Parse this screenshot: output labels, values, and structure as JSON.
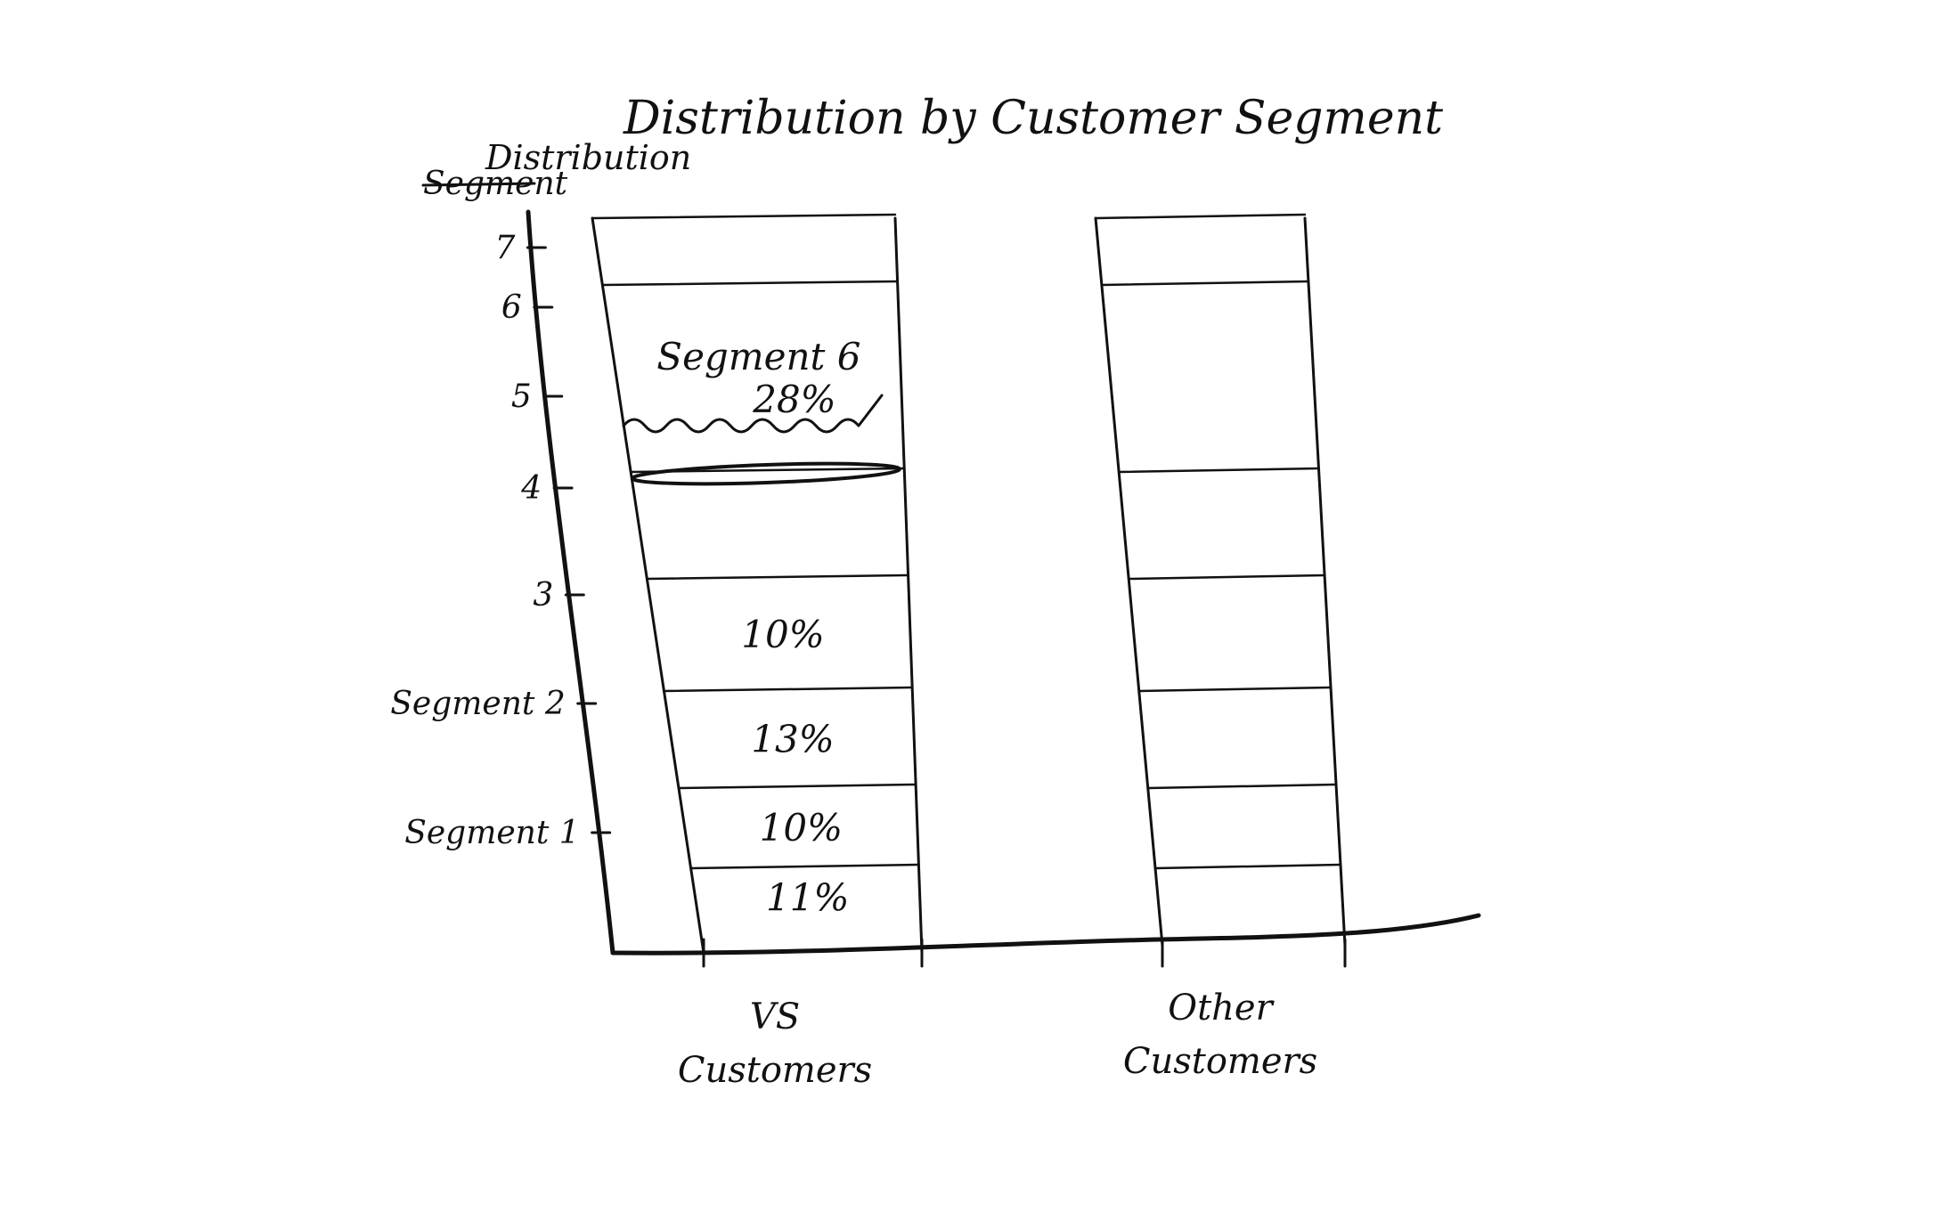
{
  "chart_data": {
    "type": "bar",
    "title": "Distribution by Customer Segment",
    "ylabel": "Distribution",
    "ylabel_struck": "Segment",
    "stacked": true,
    "categories": [
      "VS Customers",
      "Other Customers"
    ],
    "segments": [
      "Segment 1",
      "Segment 2",
      "3",
      "4",
      "5",
      "6",
      "7"
    ],
    "vs_segment_values": {
      "labels": [
        "11%",
        "10%",
        "13%",
        "10%",
        "",
        "Segment 6\n28%",
        ""
      ],
      "values": [
        11,
        10,
        13,
        10,
        null,
        28,
        null
      ]
    },
    "other_segment_values": {
      "labels": [
        "",
        "",
        "",
        "",
        "",
        "",
        ""
      ],
      "values": [
        null,
        null,
        null,
        null,
        null,
        null,
        null
      ]
    },
    "annotations": [
      "Segment 6",
      "28%"
    ]
  },
  "colors": {
    "ink": "#111111",
    "paper": "#ffffff"
  }
}
